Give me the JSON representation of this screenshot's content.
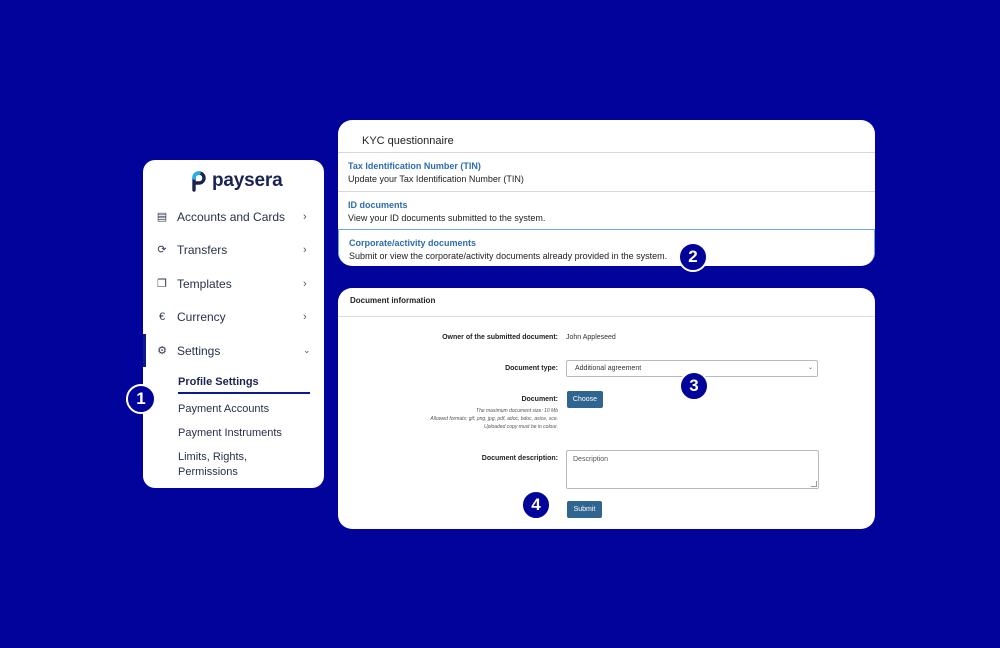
{
  "sidebar": {
    "brand": "paysera",
    "items": [
      {
        "label": "Accounts and Cards",
        "icon": "cards-icon"
      },
      {
        "label": "Transfers",
        "icon": "transfer-icon"
      },
      {
        "label": "Templates",
        "icon": "copy-icon"
      },
      {
        "label": "Currency",
        "icon": "euro-icon"
      },
      {
        "label": "Settings",
        "icon": "gear-icon"
      }
    ],
    "icon_glyphs": {
      "cards": "▤",
      "transfer": "⟳",
      "templates": "❐",
      "currency": "€",
      "settings": "⚙"
    },
    "sub_items": [
      "Profile Settings",
      "Payment Accounts",
      "Payment Instruments",
      "Limits, Rights, Permissions"
    ],
    "limits_line1": "Limits, Rights,",
    "limits_line2": "Permissions"
  },
  "badges": [
    "1",
    "2",
    "3",
    "4"
  ],
  "kyc": {
    "title": "KYC questionnaire",
    "rows": [
      {
        "title": "Tax Identification Number (TIN)",
        "desc": "Update your Tax Identification Number (TIN)"
      },
      {
        "title": "ID documents",
        "desc": "View your ID documents submitted to the system."
      },
      {
        "title": "Corporate/activity documents",
        "desc": "Submit or view the corporate/activity documents already provided in the system."
      }
    ]
  },
  "document_form": {
    "title": "Document information",
    "owner_label": "Owner of the submitted document:",
    "owner_value": "John Appleseed",
    "type_label": "Document type:",
    "type_value": "Additional agreement",
    "document_label": "Document:",
    "choose_button": "Choose",
    "hints": [
      "The maximum document size: 10 Mb",
      "Allowed formats: gif, png, jpg, pdf, adoc, bdoc, asice, sce.",
      "Uploaded copy must be in colour."
    ],
    "description_label": "Document description:",
    "description_placeholder": "Description",
    "submit_button": "Submit"
  },
  "colors": {
    "background": "#02039a",
    "link_blue": "#2d6db3",
    "button": "#2e6591",
    "active_bar": "#0b1a8c"
  }
}
